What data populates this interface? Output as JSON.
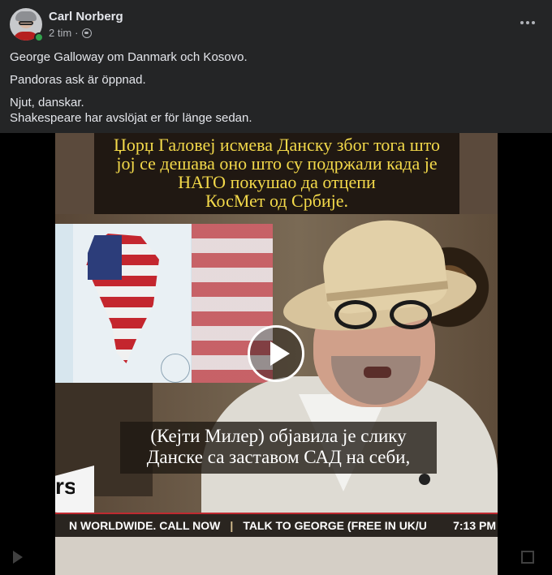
{
  "post": {
    "author": "Carl Norberg",
    "time": "2 tim",
    "separator": "·",
    "visibility_icon": "globe-icon",
    "paragraphs": [
      "George Galloway om Danmark och Kosovo.",
      "Pandoras ask är öppnad.",
      "Njut, danskar.",
      "Shakespeare har avslöjat er för länge sedan."
    ]
  },
  "video": {
    "caption_top": [
      "Џорџ Галовеј исмева Данску због тога што",
      "јој се дешава оно што су подржали када је",
      "НАТО покушао да отцепи",
      "КосМет од Србије."
    ],
    "caption_bottom": [
      "(Кејти Милер) објавила је слику",
      "Данске са заставом САД на себи,"
    ],
    "logo_text": "rs",
    "ticker_left": "N WORLDWIDE. CALL NOW",
    "ticker_separator": "|",
    "ticker_right": "TALK TO GEORGE (FREE IN UK/U",
    "ticker_time": "7:13 PM"
  },
  "colors": {
    "background": "#242526",
    "caption_yellow": "#f3d94a",
    "online": "#31a24c"
  }
}
